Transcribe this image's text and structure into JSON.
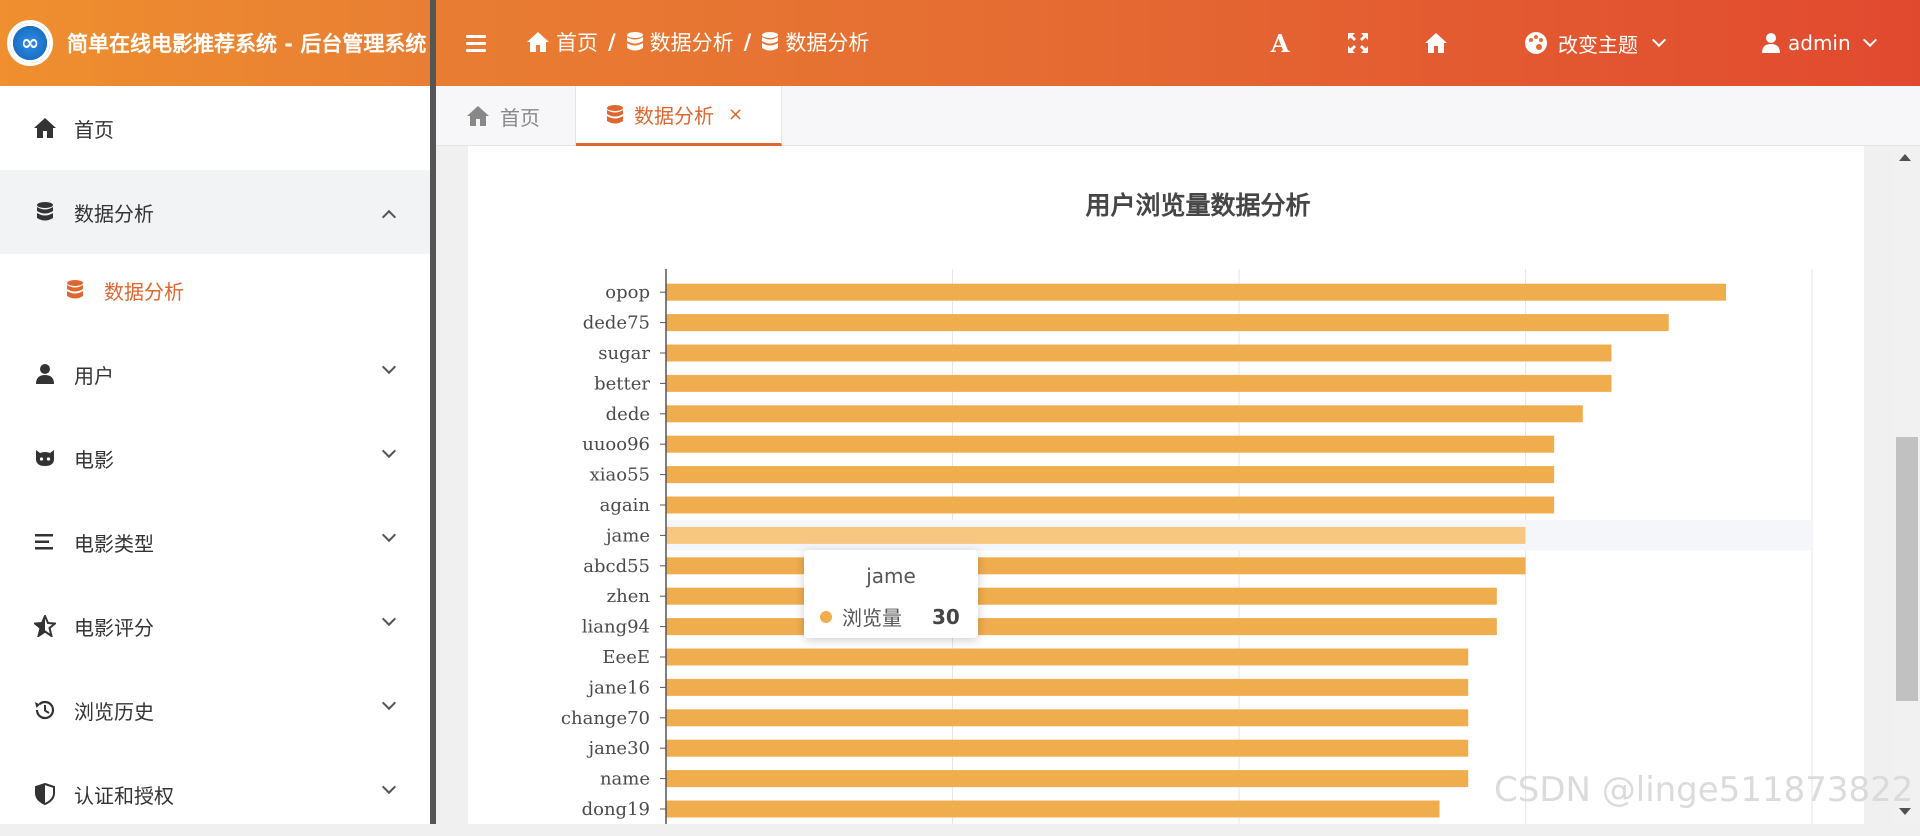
{
  "app": {
    "title": "简单在线电影推荐系统 - 后台管理系统",
    "logo_glyph": "∞"
  },
  "header": {
    "breadcrumb": [
      {
        "label": "首页",
        "icon": "home-icon"
      },
      {
        "label": "数据分析",
        "icon": "database-icon"
      },
      {
        "label": "数据分析",
        "icon": "database-icon"
      }
    ],
    "separator": "/",
    "icons": [
      "font-size-icon",
      "fullscreen-icon",
      "home-icon"
    ],
    "font_glyph": "A",
    "theme_label": "改变主题",
    "user_label": "admin"
  },
  "sidebar": {
    "items": [
      {
        "label": "首页",
        "icon": "home-icon",
        "has_children": false
      },
      {
        "label": "数据分析",
        "icon": "database-icon",
        "has_children": true,
        "expanded": true
      },
      {
        "label": "数据分析",
        "icon": "database-icon",
        "sub": true,
        "active": true
      },
      {
        "label": "用户",
        "icon": "user-icon",
        "has_children": true
      },
      {
        "label": "电影",
        "icon": "github-icon",
        "has_children": true
      },
      {
        "label": "电影类型",
        "icon": "list-icon",
        "has_children": true
      },
      {
        "label": "电影评分",
        "icon": "star-icon",
        "has_children": true
      },
      {
        "label": "浏览历史",
        "icon": "history-icon",
        "has_children": true
      },
      {
        "label": "认证和授权",
        "icon": "shield-icon",
        "has_children": true
      }
    ]
  },
  "tabs": [
    {
      "label": "首页",
      "icon": "home-icon",
      "active": false
    },
    {
      "label": "数据分析",
      "icon": "database-icon",
      "active": true,
      "close": "×"
    }
  ],
  "colors": {
    "accent": "#e0662f",
    "bar": "#f0ad4e",
    "bar_highlight": "#f8c77f"
  },
  "chart_data": {
    "type": "bar",
    "orientation": "horizontal",
    "title": "用户浏览量数据分析",
    "categories": [
      "opop",
      "dede75",
      "sugar",
      "better",
      "dede",
      "uuoo96",
      "xiao55",
      "again",
      "jame",
      "abcd55",
      "zhen",
      "liang94",
      "EeeE",
      "jane16",
      "change70",
      "jane30",
      "name",
      "dong19"
    ],
    "series": [
      {
        "name": "浏览量",
        "values": [
          37,
          35,
          33,
          33,
          32,
          31,
          31,
          31,
          30,
          30,
          29,
          29,
          28,
          28,
          28,
          28,
          28,
          27
        ]
      }
    ],
    "xlim": [
      0,
      40
    ],
    "grid": true,
    "highlighted_category": "jame"
  },
  "tooltip": {
    "title": "jame",
    "series_name": "浏览量",
    "value": "30"
  },
  "watermark": "CSDN @linge511873822"
}
